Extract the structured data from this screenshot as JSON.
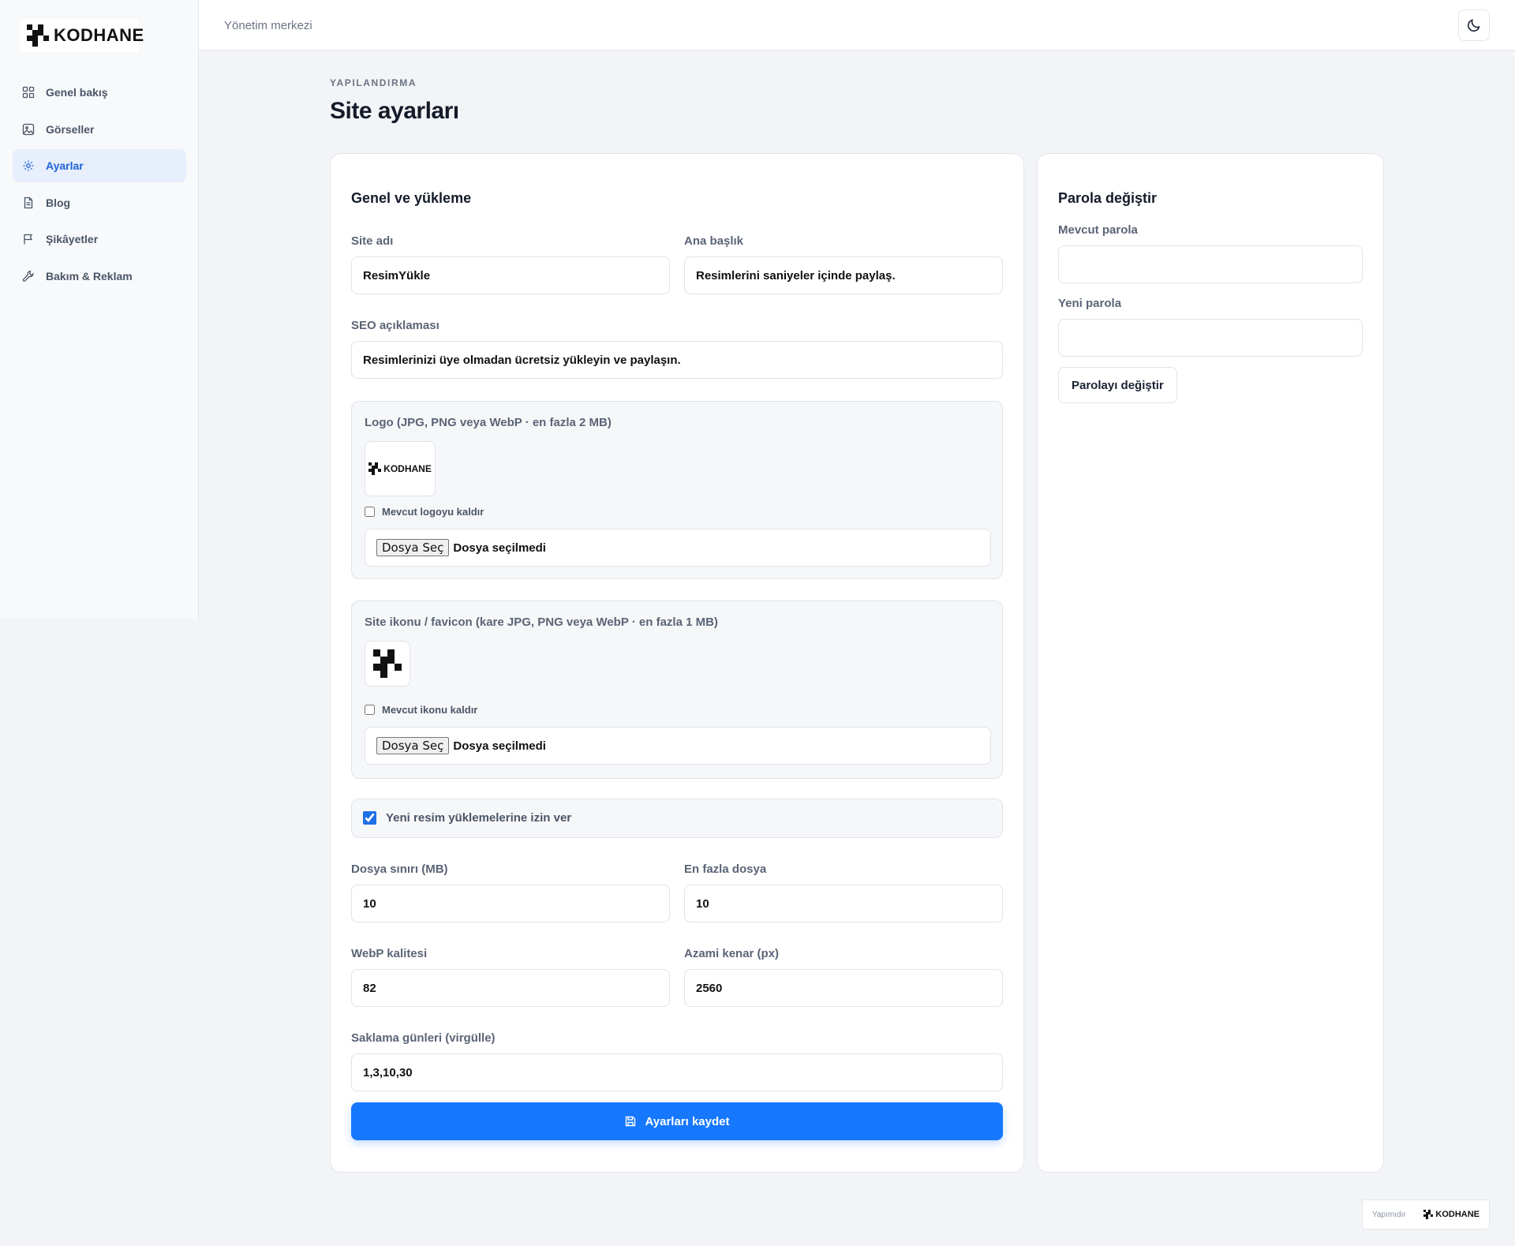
{
  "brand": {
    "name": "KODHANE"
  },
  "sidebar": {
    "items": [
      {
        "label": "Genel bakış",
        "icon": "grid-icon"
      },
      {
        "label": "Görseller",
        "icon": "image-icon"
      },
      {
        "label": "Ayarlar",
        "icon": "gear-icon",
        "active": true
      },
      {
        "label": "Blog",
        "icon": "document-icon"
      },
      {
        "label": "Şikâyetler",
        "icon": "flag-icon"
      },
      {
        "label": "Bakım & Reklam",
        "icon": "wrench-icon"
      }
    ]
  },
  "topbar": {
    "title": "Yönetim merkezi",
    "theme_icon": "moon-icon"
  },
  "page": {
    "eyebrow": "YAPILANDIRMA",
    "title": "Site ayarları"
  },
  "general": {
    "title": "Genel ve yükleme",
    "site_name": {
      "label": "Site adı",
      "value": "ResimYükle"
    },
    "headline": {
      "label": "Ana başlık",
      "value": "Resimlerini saniyeler içinde paylaş."
    },
    "seo": {
      "label": "SEO açıklaması",
      "value": "Resimlerinizi üye olmadan ücretsiz yükleyin ve paylaşın."
    },
    "logo": {
      "label": "Logo (JPG, PNG veya WebP · en fazla 2 MB)",
      "remove_label": "Mevcut logoyu kaldır",
      "file_button": "Dosya Seç",
      "file_status": "Dosya seçilmedi"
    },
    "favicon": {
      "label": "Site ikonu / favicon (kare JPG, PNG veya WebP · en fazla 1 MB)",
      "remove_label": "Mevcut ikonu kaldır",
      "file_button": "Dosya Seç",
      "file_status": "Dosya seçilmedi"
    },
    "allow_uploads": {
      "label": "Yeni resim yüklemelerine izin ver",
      "checked": true
    },
    "file_limit": {
      "label": "Dosya sınırı (MB)",
      "value": "10"
    },
    "max_files": {
      "label": "En fazla dosya",
      "value": "10"
    },
    "webp_quality": {
      "label": "WebP kalitesi",
      "value": "82"
    },
    "max_edge": {
      "label": "Azami kenar (px)",
      "value": "2560"
    },
    "retention": {
      "label": "Saklama günleri (virgülle)",
      "value": "1,3,10,30"
    },
    "save_label": "Ayarları kaydet"
  },
  "password": {
    "title": "Parola değiştir",
    "current_label": "Mevcut parola",
    "new_label": "Yeni parola",
    "button": "Parolayı değiştir"
  },
  "footer": {
    "credit_label": "Yapımıdır",
    "credit_brand": "KODHANE"
  },
  "colors": {
    "accent": "#1677ff",
    "active_nav_bg": "#e7eefc",
    "active_nav_text": "#1f63d6"
  }
}
